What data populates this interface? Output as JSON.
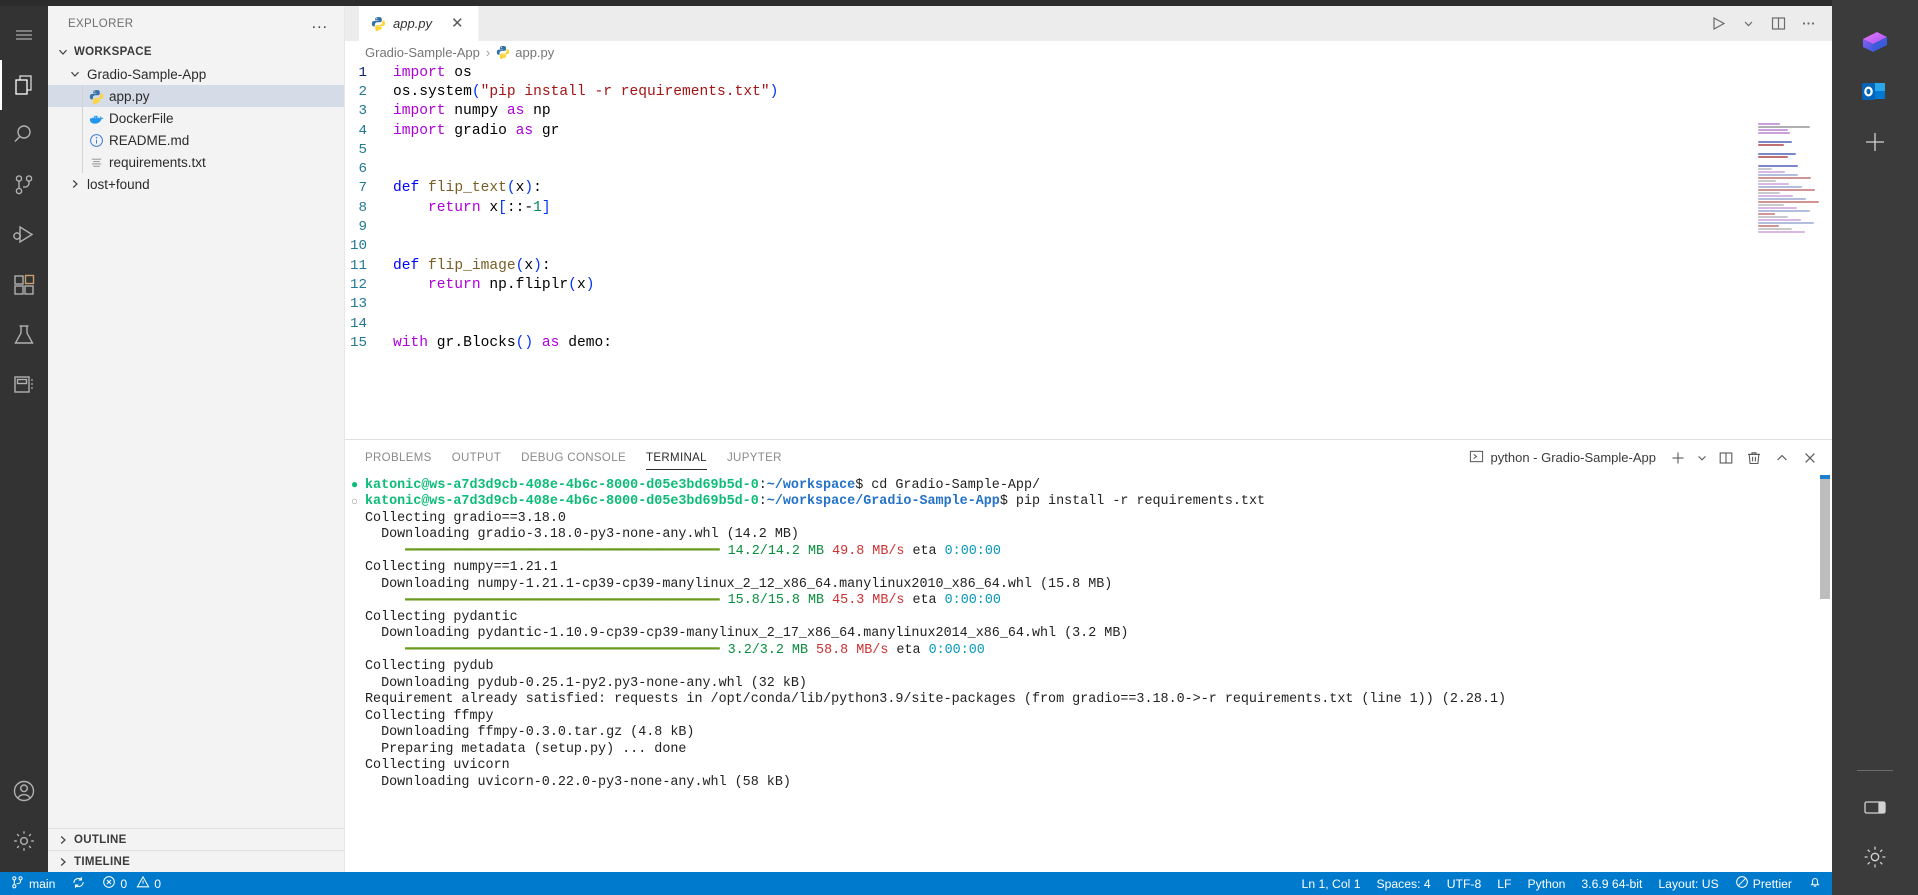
{
  "sidebar": {
    "title": "EXPLORER",
    "more_label": "...",
    "workspace_label": "WORKSPACE",
    "folder_label": "Gradio-Sample-App",
    "files": [
      {
        "label": "app.py",
        "icon": "python-icon",
        "selected": true
      },
      {
        "label": "DockerFile",
        "icon": "docker-icon",
        "selected": false
      },
      {
        "label": "README.md",
        "icon": "info-icon",
        "selected": false
      },
      {
        "label": "requirements.txt",
        "icon": "text-file-icon",
        "selected": false
      }
    ],
    "lost_found_label": "lost+found",
    "outline_label": "OUTLINE",
    "timeline_label": "TIMELINE"
  },
  "activity_bar": {
    "items": [
      {
        "name": "menu-icon",
        "label": "Menu"
      },
      {
        "name": "explorer-icon",
        "label": "Explorer"
      },
      {
        "name": "search-icon",
        "label": "Search"
      },
      {
        "name": "source-control-icon",
        "label": "Source Control"
      },
      {
        "name": "run-debug-icon",
        "label": "Run and Debug"
      },
      {
        "name": "extensions-icon",
        "label": "Extensions"
      },
      {
        "name": "testing-icon",
        "label": "Testing"
      },
      {
        "name": "remote-explorer-icon",
        "label": "Remote Explorer"
      }
    ],
    "bottom": [
      {
        "name": "account-icon",
        "label": "Accounts"
      },
      {
        "name": "settings-gear-icon",
        "label": "Manage"
      }
    ]
  },
  "editor": {
    "tab": {
      "label": "app.py",
      "icon": "python-icon",
      "close_label": "✕"
    },
    "breadcrumb": {
      "folder": "Gradio-Sample-App",
      "separator": "›",
      "file": "app.py"
    },
    "actions": [
      {
        "name": "run-python-file-button",
        "label": "Run"
      },
      {
        "name": "run-options-chevron-icon",
        "label": "Run options"
      },
      {
        "name": "split-editor-right-button",
        "label": "Split Editor Right"
      },
      {
        "name": "editor-more-actions-button",
        "label": "..."
      }
    ],
    "code": [
      {
        "n": "1",
        "tokens": [
          {
            "t": "import",
            "c": "kw"
          },
          {
            "t": " os",
            "c": "plain"
          }
        ]
      },
      {
        "n": "2",
        "tokens": [
          {
            "t": "os",
            "c": "plain"
          },
          {
            "t": ".",
            "c": "plain"
          },
          {
            "t": "system",
            "c": "plain"
          },
          {
            "t": "(",
            "c": "paren"
          },
          {
            "t": "\"pip install -r requirements.txt\"",
            "c": "str"
          },
          {
            "t": ")",
            "c": "paren"
          }
        ]
      },
      {
        "n": "3",
        "tokens": [
          {
            "t": "import",
            "c": "kw"
          },
          {
            "t": " numpy ",
            "c": "plain"
          },
          {
            "t": "as",
            "c": "kw"
          },
          {
            "t": " np",
            "c": "plain"
          }
        ]
      },
      {
        "n": "4",
        "tokens": [
          {
            "t": "import",
            "c": "kw"
          },
          {
            "t": " gradio ",
            "c": "plain"
          },
          {
            "t": "as",
            "c": "kw"
          },
          {
            "t": " gr",
            "c": "plain"
          }
        ]
      },
      {
        "n": "5",
        "tokens": []
      },
      {
        "n": "6",
        "tokens": []
      },
      {
        "n": "7",
        "tokens": [
          {
            "t": "def",
            "c": "kw2"
          },
          {
            "t": " ",
            "c": "plain"
          },
          {
            "t": "flip_text",
            "c": "fn"
          },
          {
            "t": "(",
            "c": "paren"
          },
          {
            "t": "x",
            "c": "plain"
          },
          {
            "t": ")",
            "c": "paren"
          },
          {
            "t": ":",
            "c": "plain"
          }
        ]
      },
      {
        "n": "8",
        "tokens": [
          {
            "t": "    ",
            "c": "indentguide"
          },
          {
            "t": "return",
            "c": "kw"
          },
          {
            "t": " x",
            "c": "plain"
          },
          {
            "t": "[",
            "c": "paren"
          },
          {
            "t": "::",
            "c": "plain"
          },
          {
            "t": "-",
            "c": "plain"
          },
          {
            "t": "1",
            "c": "num"
          },
          {
            "t": "]",
            "c": "paren"
          }
        ]
      },
      {
        "n": "9",
        "tokens": []
      },
      {
        "n": "10",
        "tokens": []
      },
      {
        "n": "11",
        "tokens": [
          {
            "t": "def",
            "c": "kw2"
          },
          {
            "t": " ",
            "c": "plain"
          },
          {
            "t": "flip_image",
            "c": "fn"
          },
          {
            "t": "(",
            "c": "paren"
          },
          {
            "t": "x",
            "c": "plain"
          },
          {
            "t": ")",
            "c": "paren"
          },
          {
            "t": ":",
            "c": "plain"
          }
        ]
      },
      {
        "n": "12",
        "tokens": [
          {
            "t": "    ",
            "c": "indentguide"
          },
          {
            "t": "return",
            "c": "kw"
          },
          {
            "t": " np",
            "c": "plain"
          },
          {
            "t": ".",
            "c": "plain"
          },
          {
            "t": "fliplr",
            "c": "plain"
          },
          {
            "t": "(",
            "c": "paren"
          },
          {
            "t": "x",
            "c": "plain"
          },
          {
            "t": ")",
            "c": "paren"
          }
        ]
      },
      {
        "n": "13",
        "tokens": []
      },
      {
        "n": "14",
        "tokens": []
      },
      {
        "n": "15",
        "tokens": [
          {
            "t": "with",
            "c": "kw"
          },
          {
            "t": " gr",
            "c": "plain"
          },
          {
            "t": ".",
            "c": "plain"
          },
          {
            "t": "Blocks",
            "c": "plain"
          },
          {
            "t": "(",
            "c": "paren"
          },
          {
            "t": ")",
            "c": "paren"
          },
          {
            "t": " ",
            "c": "plain"
          },
          {
            "t": "as",
            "c": "kw"
          },
          {
            "t": " demo",
            "c": "plain"
          },
          {
            "t": ":",
            "c": "plain"
          }
        ]
      }
    ]
  },
  "panel": {
    "tabs": [
      {
        "label": "PROBLEMS",
        "active": false
      },
      {
        "label": "OUTPUT",
        "active": false
      },
      {
        "label": "DEBUG CONSOLE",
        "active": false
      },
      {
        "label": "TERMINAL",
        "active": true
      },
      {
        "label": "JUPYTER",
        "active": false
      }
    ],
    "terminal_selector": "python - Gradio-Sample-App",
    "actions": [
      {
        "name": "new-terminal-button",
        "label": "+"
      },
      {
        "name": "terminal-dropdown-chevron-icon",
        "label": "⌄"
      },
      {
        "name": "split-terminal-button",
        "label": "Split"
      },
      {
        "name": "kill-terminal-button",
        "label": "Trash"
      },
      {
        "name": "maximize-panel-chevron-icon",
        "label": "^"
      },
      {
        "name": "close-panel-button",
        "label": "✕"
      }
    ],
    "terminal_lines": [
      {
        "bullet": "filled",
        "segs": [
          {
            "t": "katonic@ws-a7d3d9cb-408e-4b6c-8000-d05e3bd69b5d-0",
            "c": "t-user"
          },
          {
            "t": ":",
            "c": ""
          },
          {
            "t": "~/workspace",
            "c": "t-path"
          },
          {
            "t": "$ cd Gradio-Sample-App/",
            "c": ""
          }
        ]
      },
      {
        "bullet": "hollow",
        "segs": [
          {
            "t": "katonic@ws-a7d3d9cb-408e-4b6c-8000-d05e3bd69b5d-0",
            "c": "t-user"
          },
          {
            "t": ":",
            "c": ""
          },
          {
            "t": "~/workspace/Gradio-Sample-App",
            "c": "t-path"
          },
          {
            "t": "$ pip install -r requirements.txt",
            "c": ""
          }
        ]
      },
      {
        "bullet": "",
        "segs": [
          {
            "t": "Collecting gradio==3.18.0",
            "c": ""
          }
        ]
      },
      {
        "bullet": "",
        "segs": [
          {
            "t": "  Downloading gradio-3.18.0-py3-none-any.whl (14.2 MB)",
            "c": ""
          }
        ]
      },
      {
        "bullet": "",
        "segs": [
          {
            "t": "     ━━━━━━━━━━━━━━━━━━━━━━━━━━━━━━━━━━━━━━━ ",
            "c": "t-bar"
          },
          {
            "t": "14.2/14.2 MB",
            "c": "t-green"
          },
          {
            "t": " ",
            "c": ""
          },
          {
            "t": "49.8 MB/s",
            "c": "t-red"
          },
          {
            "t": " eta ",
            "c": ""
          },
          {
            "t": "0:00:00",
            "c": "t-cyan"
          }
        ]
      },
      {
        "bullet": "",
        "segs": [
          {
            "t": "Collecting numpy==1.21.1",
            "c": ""
          }
        ]
      },
      {
        "bullet": "",
        "segs": [
          {
            "t": "  Downloading numpy-1.21.1-cp39-cp39-manylinux_2_12_x86_64.manylinux2010_x86_64.whl (15.8 MB)",
            "c": ""
          }
        ]
      },
      {
        "bullet": "",
        "segs": [
          {
            "t": "     ━━━━━━━━━━━━━━━━━━━━━━━━━━━━━━━━━━━━━━━ ",
            "c": "t-bar"
          },
          {
            "t": "15.8/15.8 MB",
            "c": "t-green"
          },
          {
            "t": " ",
            "c": ""
          },
          {
            "t": "45.3 MB/s",
            "c": "t-red"
          },
          {
            "t": " eta ",
            "c": ""
          },
          {
            "t": "0:00:00",
            "c": "t-cyan"
          }
        ]
      },
      {
        "bullet": "",
        "segs": [
          {
            "t": "Collecting pydantic",
            "c": ""
          }
        ]
      },
      {
        "bullet": "",
        "segs": [
          {
            "t": "  Downloading pydantic-1.10.9-cp39-cp39-manylinux_2_17_x86_64.manylinux2014_x86_64.whl (3.2 MB)",
            "c": ""
          }
        ]
      },
      {
        "bullet": "",
        "segs": [
          {
            "t": "     ━━━━━━━━━━━━━━━━━━━━━━━━━━━━━━━━━━━━━━━ ",
            "c": "t-bar"
          },
          {
            "t": "3.2/3.2 MB",
            "c": "t-green"
          },
          {
            "t": " ",
            "c": ""
          },
          {
            "t": "58.8 MB/s",
            "c": "t-red"
          },
          {
            "t": " eta ",
            "c": ""
          },
          {
            "t": "0:00:00",
            "c": "t-cyan"
          }
        ]
      },
      {
        "bullet": "",
        "segs": [
          {
            "t": "Collecting pydub",
            "c": ""
          }
        ]
      },
      {
        "bullet": "",
        "segs": [
          {
            "t": "  Downloading pydub-0.25.1-py2.py3-none-any.whl (32 kB)",
            "c": ""
          }
        ]
      },
      {
        "bullet": "",
        "segs": [
          {
            "t": "Requirement already satisfied: requests in /opt/conda/lib/python3.9/site-packages (from gradio==3.18.0->-r requirements.txt (line 1)) (2.28.1)",
            "c": ""
          }
        ]
      },
      {
        "bullet": "",
        "segs": [
          {
            "t": "Collecting ffmpy",
            "c": ""
          }
        ]
      },
      {
        "bullet": "",
        "segs": [
          {
            "t": "  Downloading ffmpy-0.3.0.tar.gz (4.8 kB)",
            "c": ""
          }
        ]
      },
      {
        "bullet": "",
        "segs": [
          {
            "t": "  Preparing metadata (setup.py) ... done",
            "c": ""
          }
        ]
      },
      {
        "bullet": "",
        "segs": [
          {
            "t": "Collecting uvicorn",
            "c": ""
          }
        ]
      },
      {
        "bullet": "",
        "segs": [
          {
            "t": "  Downloading uvicorn-0.22.0-py3-none-any.whl (58 kB)",
            "c": ""
          }
        ]
      }
    ]
  },
  "status_bar": {
    "branch": "main",
    "sync_icon": "sync-icon",
    "errors": "0",
    "warnings": "0",
    "cursor_position": "Ln 1, Col 1",
    "indentation": "Spaces: 4",
    "encoding": "UTF-8",
    "eol": "LF",
    "language": "Python",
    "interpreter": "3.6.9 64-bit",
    "layout": "Layout: US",
    "formatter": "Prettier",
    "bell_icon": "bell-icon"
  },
  "right_rail": {
    "items": [
      {
        "name": "microsoft-365-icon",
        "label": "Microsoft 365"
      },
      {
        "name": "outlook-icon",
        "label": "Outlook"
      },
      {
        "name": "add-app-icon",
        "label": "Add"
      }
    ],
    "bottom": [
      {
        "name": "panel-layout-icon",
        "label": "Layout"
      },
      {
        "name": "settings-gear-icon",
        "label": "Settings"
      }
    ]
  },
  "colors": {
    "accent_blue": "#007acc",
    "activity_bar_bg": "#333333",
    "sidebar_bg": "#f3f3f3",
    "editor_bg": "#ffffff",
    "selection_bg": "#d6dbe8",
    "terminal_green": "#0dbc79",
    "terminal_blue": "#2472c8",
    "progress_bar": "#6a9a1f"
  }
}
